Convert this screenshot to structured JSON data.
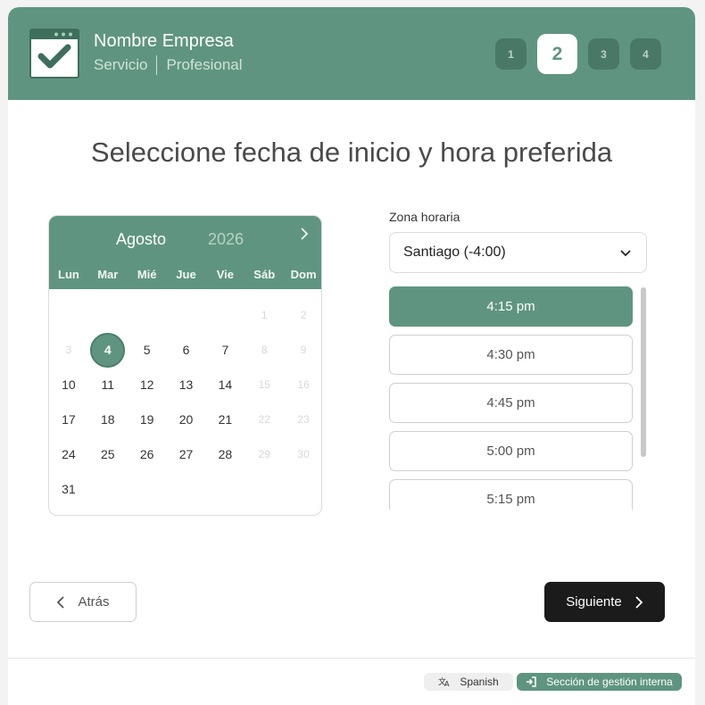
{
  "header": {
    "company_name": "Nombre Empresa",
    "service": "Servicio",
    "professional": "Profesional",
    "steps": [
      "1",
      "2",
      "3",
      "4"
    ],
    "active_step": 2
  },
  "title": "Seleccione fecha de inicio y hora preferida",
  "calendar": {
    "month": "Agosto",
    "year": "2026",
    "weekdays": [
      "Lun",
      "Mar",
      "Mié",
      "Jue",
      "Vie",
      "Sáb",
      "Dom"
    ],
    "weeks": [
      [
        "",
        "",
        "",
        "",
        "",
        "1",
        "2"
      ],
      [
        "3",
        "4",
        "5",
        "6",
        "7",
        "8",
        "9"
      ],
      [
        "10",
        "11",
        "12",
        "13",
        "14",
        "15",
        "16"
      ],
      [
        "17",
        "18",
        "19",
        "20",
        "21",
        "22",
        "23"
      ],
      [
        "24",
        "25",
        "26",
        "27",
        "28",
        "29",
        "30"
      ],
      [
        "31",
        "",
        "",
        "",
        "",
        "",
        ""
      ]
    ],
    "disabled_days": [
      "1",
      "2",
      "3",
      "8",
      "9",
      "15",
      "16",
      "22",
      "23",
      "29",
      "30"
    ],
    "selected_day": "4"
  },
  "timezone": {
    "label": "Zona horaria",
    "value": "Santiago (-4:00)"
  },
  "time_slots": [
    "4:15 pm",
    "4:30 pm",
    "4:45 pm",
    "5:00 pm",
    "5:15 pm"
  ],
  "selected_slot": "4:15 pm",
  "buttons": {
    "back": "Atrás",
    "next": "Siguiente"
  },
  "footer": {
    "language": "Spanish",
    "internal": "Sección de gestión interna"
  },
  "colors": {
    "primary": "#5f9580",
    "dark_button": "#1b1b1b"
  }
}
